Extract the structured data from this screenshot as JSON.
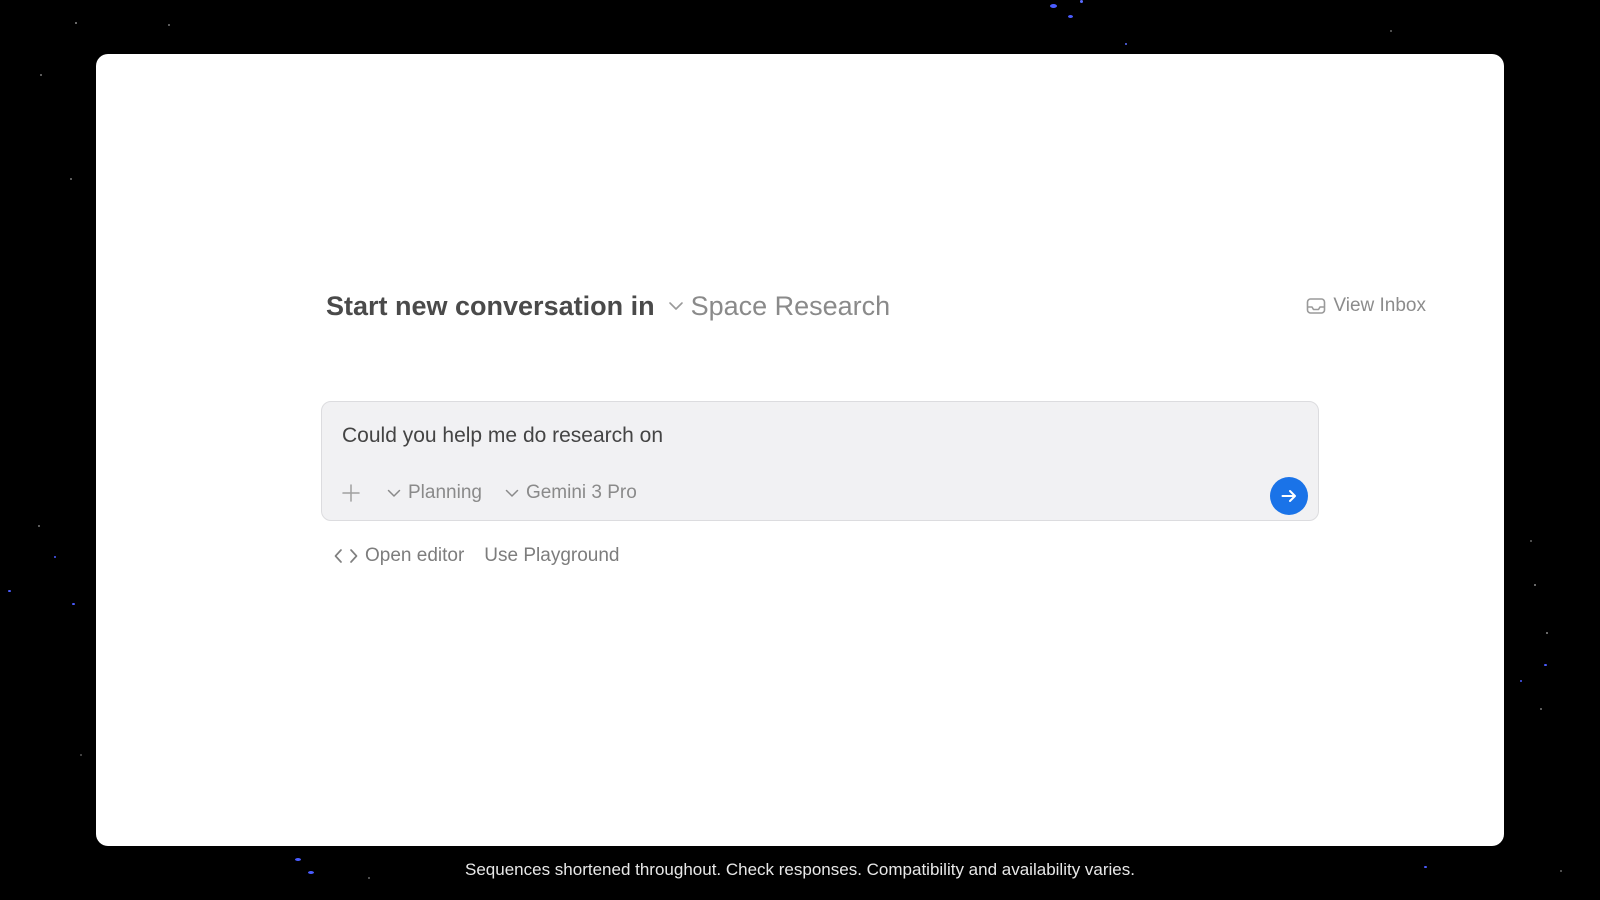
{
  "header": {
    "title_prefix": "Start new conversation in",
    "workspace": "Space Research",
    "view_inbox_label": "View Inbox"
  },
  "composer": {
    "prompt_value": "Could you help me do research on",
    "mode_label": "Planning",
    "model_label": "Gemini 3 Pro",
    "send_color": "#1a73e8"
  },
  "actions": {
    "open_editor_label": "Open editor",
    "playground_label": "Use Playground"
  },
  "footer": {
    "caption": "Sequences shortened throughout. Check responses. Compatibility and availability varies."
  }
}
